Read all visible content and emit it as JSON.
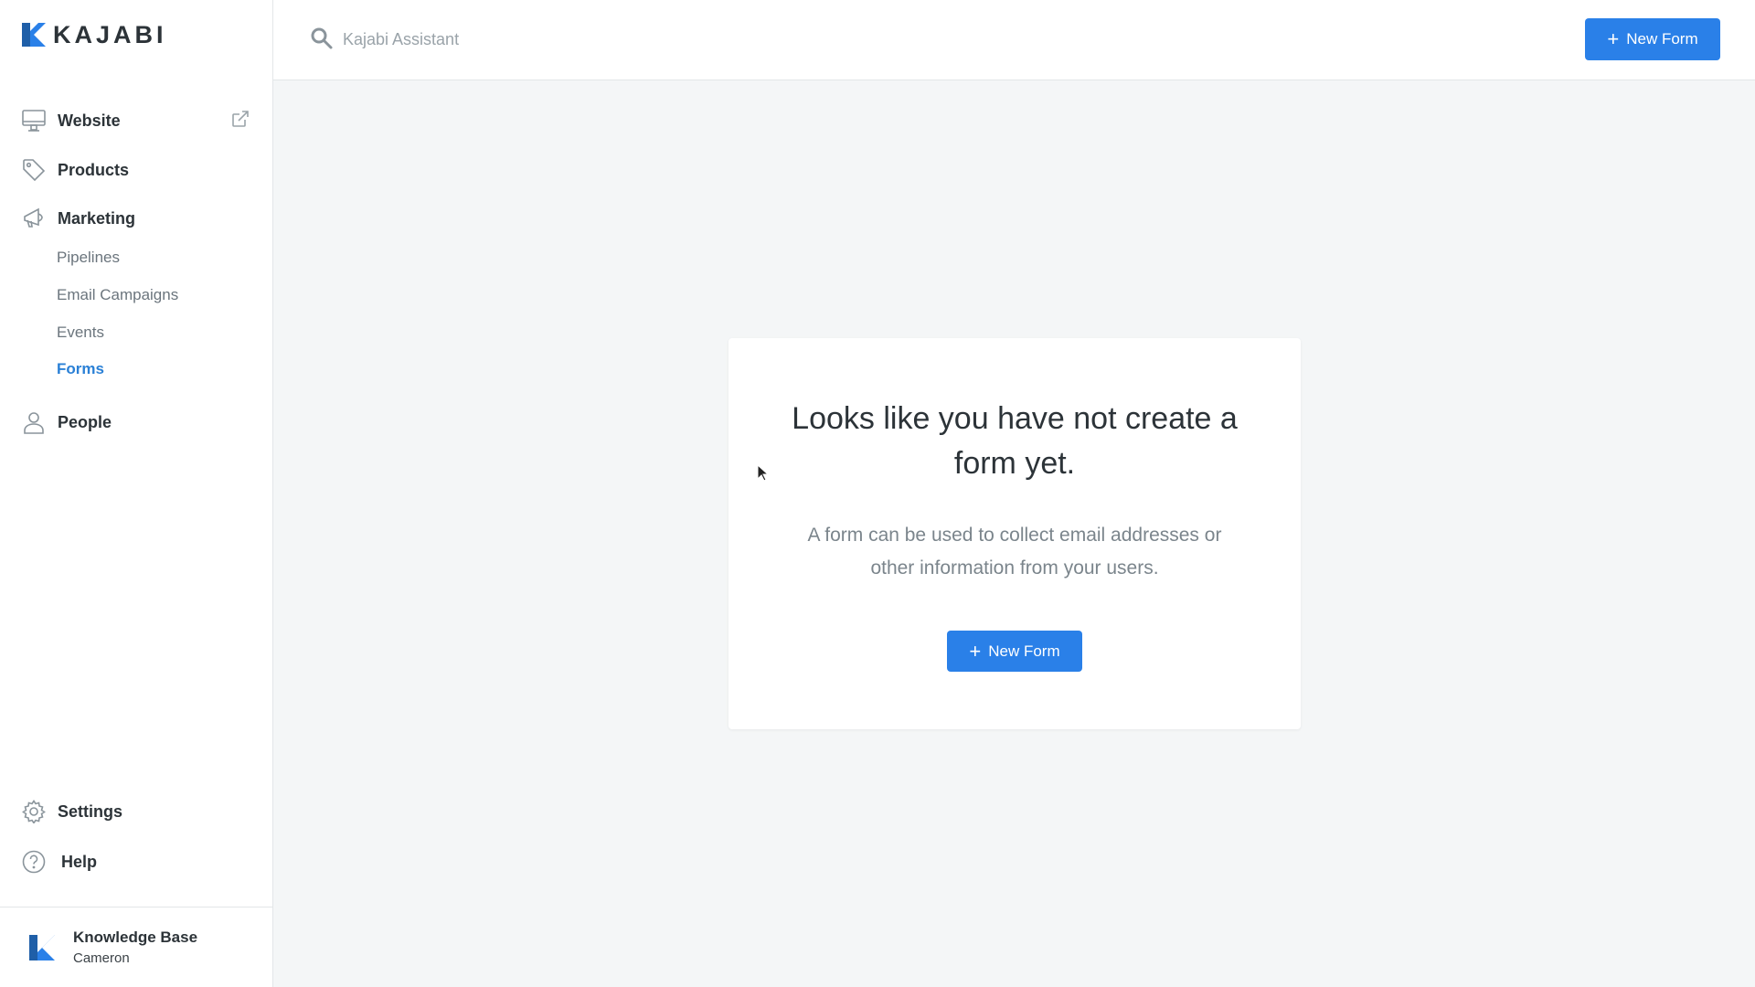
{
  "brand": {
    "wordmark": "KAJABI",
    "accent": "#2a80e8"
  },
  "sidebar": {
    "items": {
      "website": {
        "label": "Website",
        "icon": "monitor-icon"
      },
      "products": {
        "label": "Products",
        "icon": "tag-icon"
      },
      "marketing": {
        "label": "Marketing",
        "icon": "megaphone-icon"
      },
      "people": {
        "label": "People",
        "icon": "user-icon"
      },
      "settings": {
        "label": "Settings",
        "icon": "gear-icon"
      },
      "help": {
        "label": "Help",
        "icon": "question-circle-icon"
      }
    },
    "marketing_sub": {
      "pipelines": "Pipelines",
      "email_campaigns": "Email Campaigns",
      "events": "Events",
      "forms": "Forms"
    },
    "active_sub": "Forms",
    "footer": {
      "site_name": "Knowledge Base",
      "user": "Cameron"
    }
  },
  "topbar": {
    "search_placeholder": "Kajabi Assistant",
    "new_button": "New Form"
  },
  "empty_state": {
    "title": "Looks like you have not create a form yet.",
    "description": "A form can be used to collect email addresses or other information from your users.",
    "button": "New Form"
  }
}
